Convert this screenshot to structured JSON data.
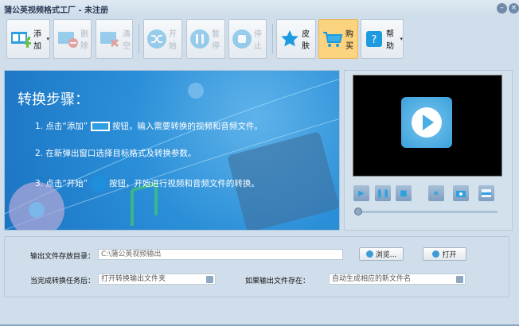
{
  "window": {
    "title": "蒲公英视频格式工厂 - 未注册",
    "minimize": "–",
    "close": "×"
  },
  "toolbar": {
    "add": "添加",
    "delete": "删除",
    "clear": "清空",
    "start": "开始",
    "pause": "暂停",
    "stop": "停止",
    "skin": "皮肤",
    "buy": "购买",
    "help": "帮助",
    "dropdown_arrow": "▾"
  },
  "banner": {
    "heading": "转换步骤：",
    "step1_a": "1. 点击“添加”",
    "step1_b": "按钮，输入需要转换的视频和音频文件。",
    "step2": "2. 在新弹出窗口选择目标格式及转换参数。",
    "step3_a": "3. 点击“开始”",
    "step3_b": "按钮，开始进行视频和音频文件的转换。"
  },
  "player": {
    "seek_position": 0
  },
  "settings": {
    "output_dir_label": "输出文件存放目录：",
    "output_dir_value": "C:\\蒲公英视频输出",
    "browse": "浏览...",
    "open": "打开",
    "after_label": "当完成转换任务后：",
    "after_value": "打开转换输出文件夹",
    "exists_label": "如果输出文件存在：",
    "exists_value": "自动生成相应的新文件名"
  },
  "colors": {
    "accent": "#2ea0e0",
    "buy_highlight": "#fcd37e"
  }
}
